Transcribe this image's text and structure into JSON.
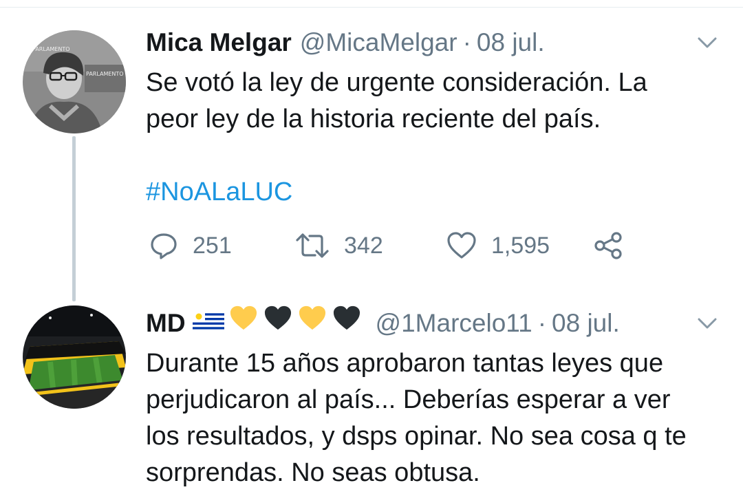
{
  "tweet1": {
    "name": "Mica Melgar",
    "handle": "@MicaMelgar",
    "separator": "·",
    "date": "08 jul.",
    "text_lines": [
      "Se votó la ley de urgente consideración. La",
      "peor ley de la historia reciente del país."
    ],
    "hashtag": "#NoALaLUC",
    "avatar_text_top": "PARLAMENTO",
    "avatar_text_side": "PARLAMENTO",
    "actions": {
      "replies": "251",
      "retweets": "342",
      "likes": "1,595"
    }
  },
  "tweet2": {
    "name": "MD",
    "badge_icons": [
      "uruguay-flag-emoji",
      "yellow-heart-emoji",
      "black-heart-emoji",
      "yellow-heart-emoji",
      "black-heart-emoji"
    ],
    "handle": "@1Marcelo11",
    "separator": "·",
    "date": "08 jul.",
    "text_lines": [
      "Durante 15 años aprobaron tantas leyes que",
      "perjudicaron al país... Deberías esperar a ver",
      "los resultados, y dsps opinar. No sea cosa q te",
      "sorprendas. No seas obtusa."
    ]
  },
  "colors": {
    "link": "#1b95e0",
    "secondary_text": "#657786",
    "primary_text": "#14171a",
    "thread_line": "#c4cfd6",
    "heart_yellow": "#ffcc4d",
    "heart_black": "#292f33"
  }
}
